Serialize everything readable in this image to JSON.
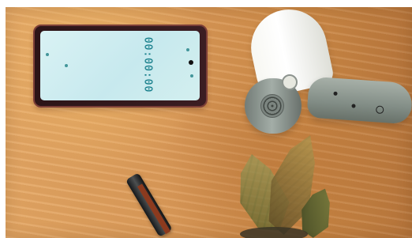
{
  "phone": {
    "timer": "00:00:00"
  }
}
